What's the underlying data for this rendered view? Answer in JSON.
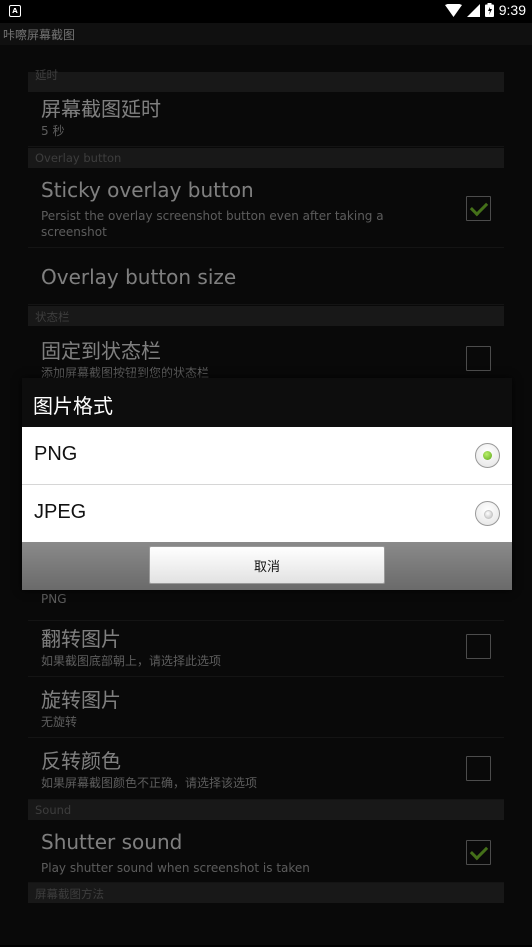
{
  "statusbar": {
    "time": "9:39"
  },
  "appbar": {
    "title": "咔嚓屏幕截图"
  },
  "settings": {
    "cat_delay": "延时",
    "delay_title": "屏幕截图延时",
    "delay_summary": "5 秒",
    "cat_overlay": "Overlay button",
    "sticky_title": "Sticky overlay button",
    "sticky_summary": "Persist the overlay screenshot button even after taking a screenshot",
    "sticky_checked": true,
    "overlay_size_title": "Overlay button size",
    "cat_statusbar": "状态栏",
    "pin_title": "固定到状态栏",
    "pin_summary": "添加屏幕截图按钮到您的状态栏",
    "pin_checked": false,
    "format_summary": "PNG",
    "flip_title": "翻转图片",
    "flip_summary": "如果截图底部朝上，请选择此选项",
    "flip_checked": false,
    "rotate_title": "旋转图片",
    "rotate_summary": "无旋转",
    "invert_title": "反转颜色",
    "invert_summary": "如果屏幕截图颜色不正确，请选择该选项",
    "invert_checked": false,
    "cat_sound": "Sound",
    "shutter_title": "Shutter sound",
    "shutter_summary": "Play shutter sound when screenshot is taken",
    "shutter_checked": true,
    "cat_method": "屏幕截图方法"
  },
  "dialog": {
    "title": "图片格式",
    "options": [
      {
        "label": "PNG",
        "selected": true
      },
      {
        "label": "JPEG",
        "selected": false
      }
    ],
    "cancel_label": "取消"
  }
}
